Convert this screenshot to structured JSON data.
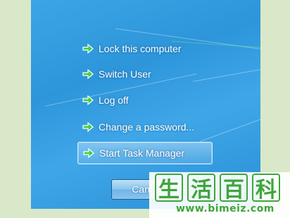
{
  "menu": {
    "items": [
      {
        "label": "Lock this computer"
      },
      {
        "label": "Switch User"
      },
      {
        "label": "Log off"
      },
      {
        "label": "Change a password..."
      },
      {
        "label": "Start Task Manager",
        "selected": true
      }
    ]
  },
  "cancel_button": {
    "label": "Cancel"
  },
  "watermark": {
    "chars": [
      "生",
      "活",
      "百",
      "科"
    ],
    "url": "www.bimeiz.com"
  },
  "colors": {
    "background": "#2d95da",
    "arrow_green": "#3fcf3f",
    "watermark_green": "#3fa53a"
  },
  "icons": {
    "menu_item": "green-arrow-icon"
  }
}
